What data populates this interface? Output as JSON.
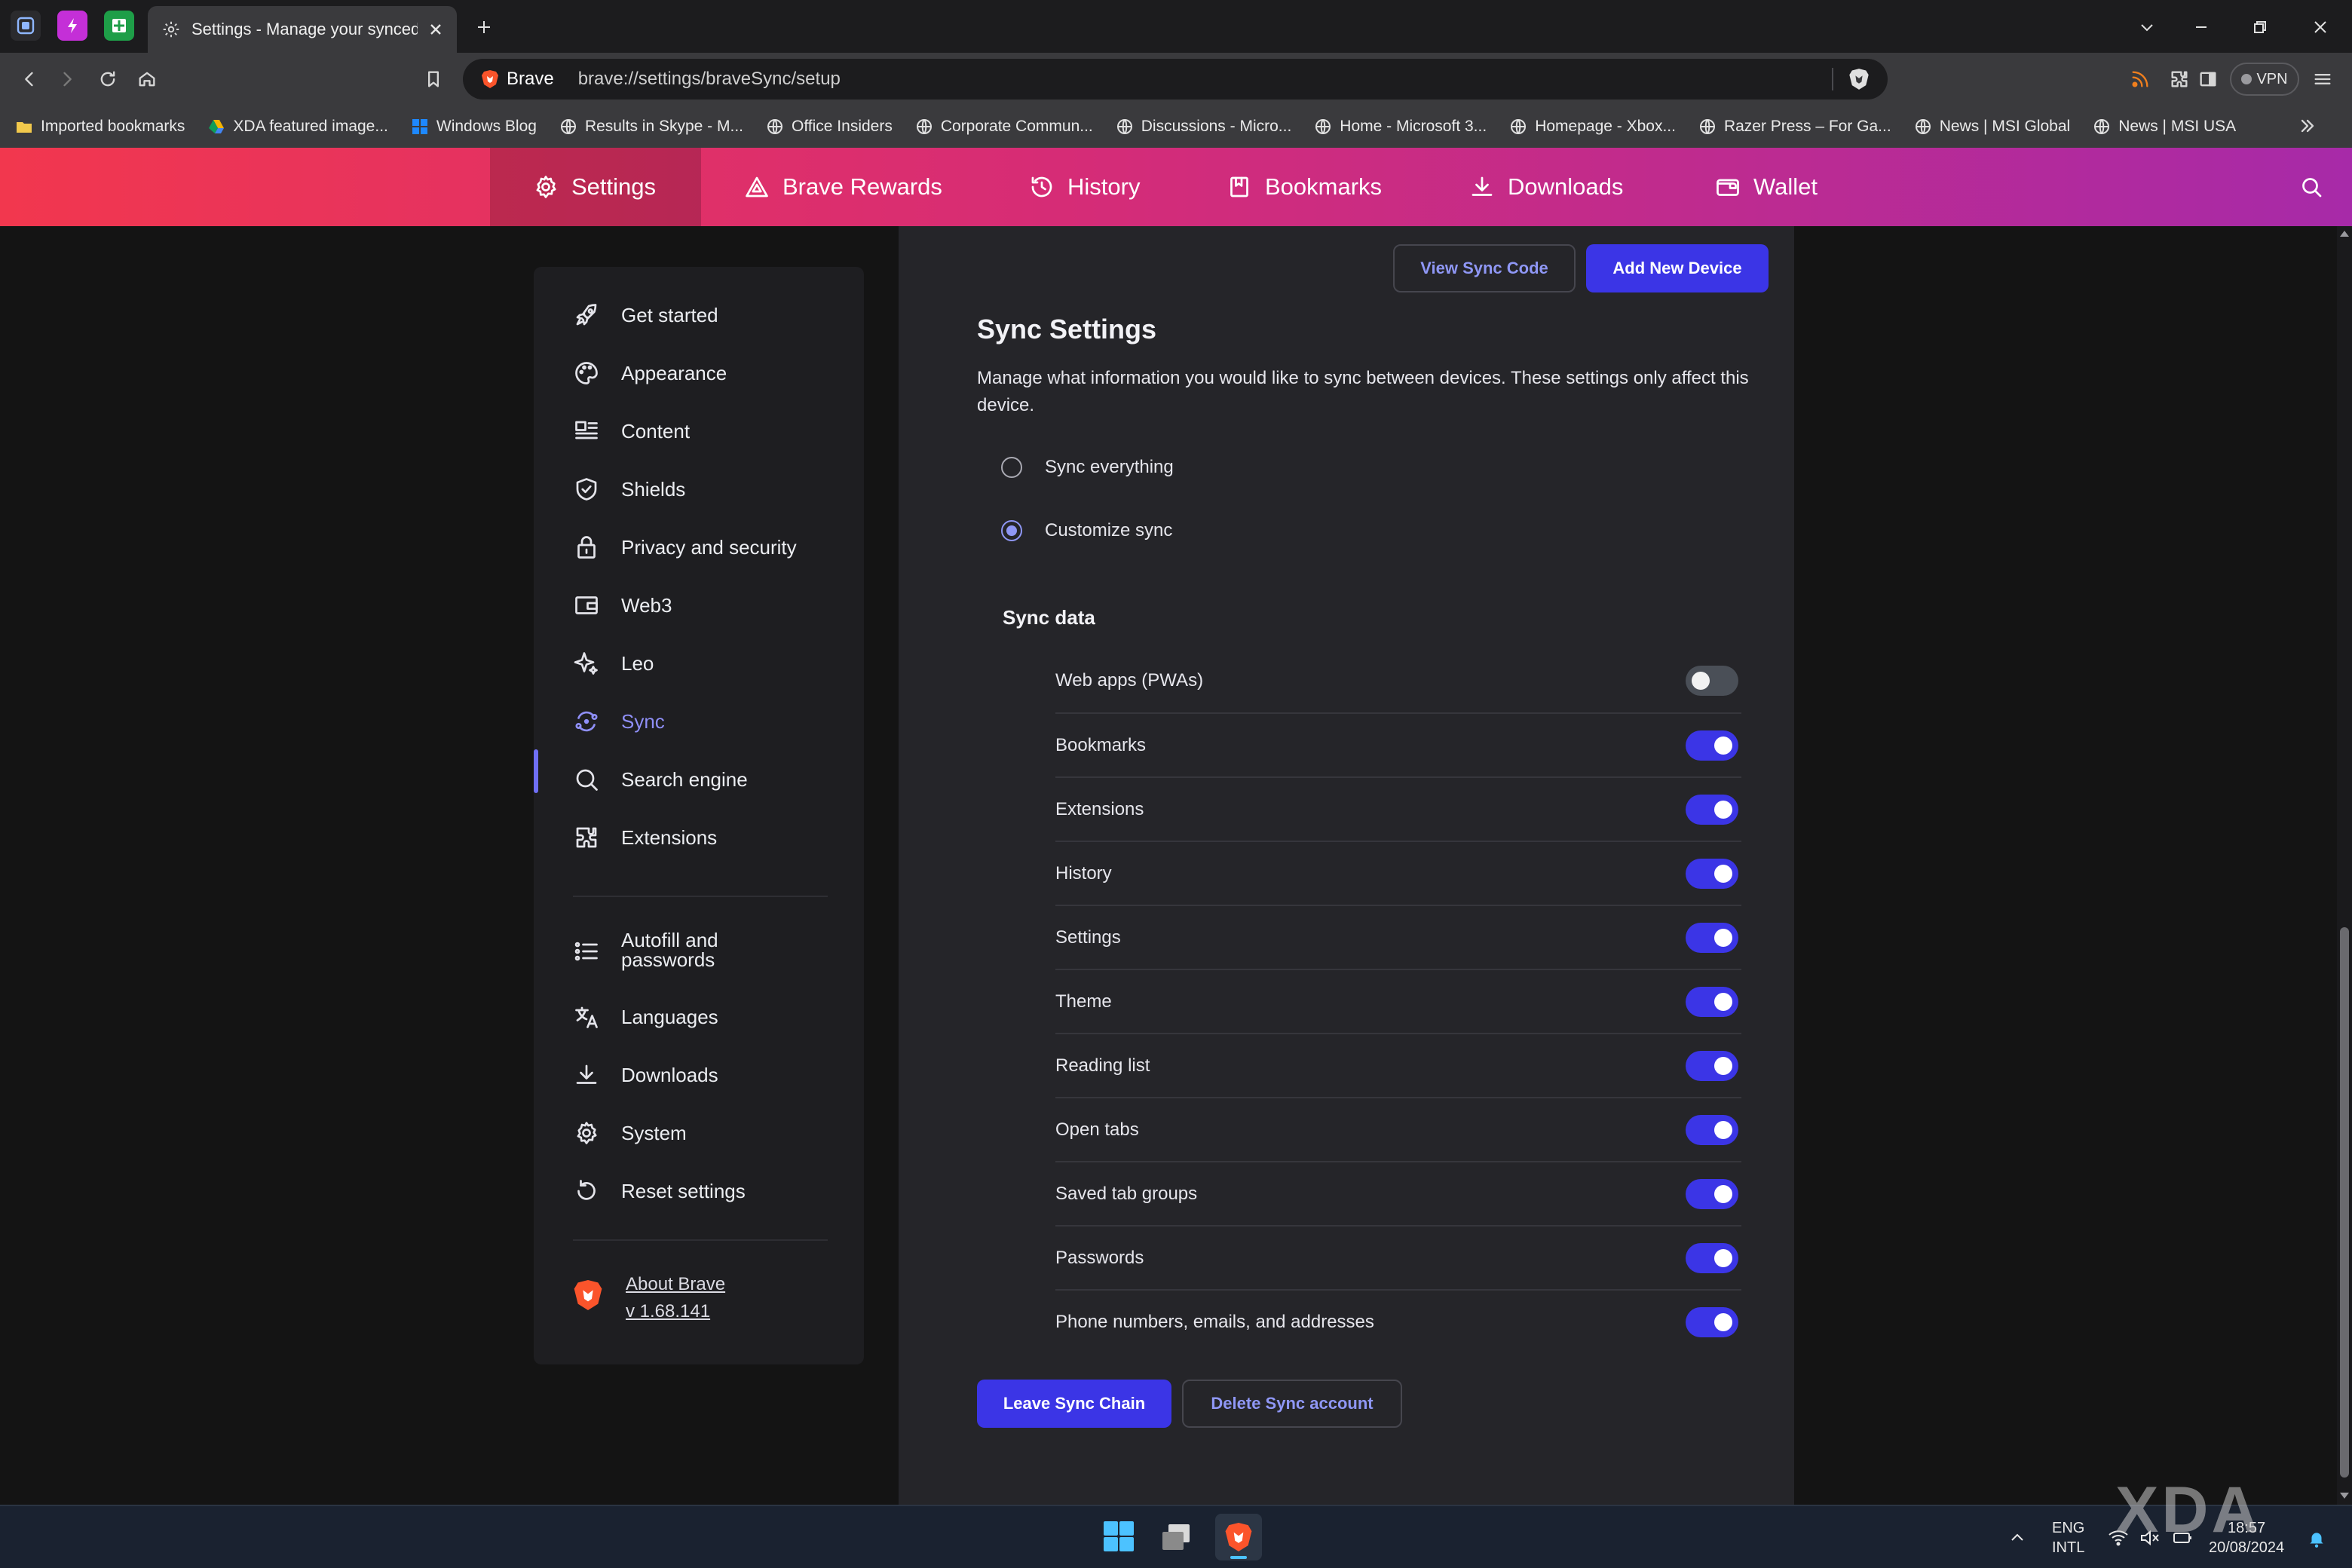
{
  "browser": {
    "tab_title": "Settings - Manage your synced",
    "brand": "Brave",
    "url": "brave://settings/braveSync/setup",
    "vpn_label": "VPN"
  },
  "bookmarks": [
    {
      "label": "Imported bookmarks",
      "icon": "folder-icon"
    },
    {
      "label": "XDA featured image...",
      "icon": "drive-icon"
    },
    {
      "label": "Windows Blog",
      "icon": "windows-icon"
    },
    {
      "label": "Results in Skype - M...",
      "icon": "globe-icon"
    },
    {
      "label": "Office Insiders",
      "icon": "globe-icon"
    },
    {
      "label": "Corporate Commun...",
      "icon": "globe-icon"
    },
    {
      "label": "Discussions - Micro...",
      "icon": "globe-icon"
    },
    {
      "label": "Home - Microsoft 3...",
      "icon": "globe-icon"
    },
    {
      "label": "Homepage - Xbox...",
      "icon": "globe-icon"
    },
    {
      "label": "Razer Press – For Ga...",
      "icon": "globe-icon"
    },
    {
      "label": "News | MSI Global",
      "icon": "globe-icon"
    },
    {
      "label": "News | MSI USA",
      "icon": "globe-icon"
    }
  ],
  "nav": {
    "settings": "Settings",
    "rewards": "Brave Rewards",
    "history": "History",
    "bookmarks": "Bookmarks",
    "downloads": "Downloads",
    "wallet": "Wallet"
  },
  "sidebar": {
    "items": [
      {
        "label": "Get started",
        "icon": "rocket-icon"
      },
      {
        "label": "Appearance",
        "icon": "palette-icon"
      },
      {
        "label": "Content",
        "icon": "content-icon"
      },
      {
        "label": "Shields",
        "icon": "shield-icon"
      },
      {
        "label": "Privacy and security",
        "icon": "lock-icon"
      },
      {
        "label": "Web3",
        "icon": "wallet-icon"
      },
      {
        "label": "Leo",
        "icon": "sparkle-icon"
      },
      {
        "label": "Sync",
        "icon": "sync-icon",
        "active": true
      },
      {
        "label": "Search engine",
        "icon": "search-icon"
      },
      {
        "label": "Extensions",
        "icon": "puzzle-icon"
      },
      {
        "label": "Autofill and passwords",
        "icon": "list-icon"
      },
      {
        "label": "Languages",
        "icon": "translate-icon"
      },
      {
        "label": "Downloads",
        "icon": "download-icon"
      },
      {
        "label": "System",
        "icon": "gear-icon"
      },
      {
        "label": "Reset settings",
        "icon": "reset-icon"
      }
    ],
    "about_label": "About Brave",
    "version": "v 1.68.141"
  },
  "sync": {
    "view_code_label": "View Sync Code",
    "add_device_label": "Add New Device",
    "title": "Sync Settings",
    "description": "Manage what information you would like to sync between devices. These settings only affect this device.",
    "options": [
      {
        "label": "Sync everything",
        "selected": false
      },
      {
        "label": "Customize sync",
        "selected": true
      }
    ],
    "data_label": "Sync data",
    "items": [
      {
        "label": "Web apps (PWAs)",
        "enabled": false
      },
      {
        "label": "Bookmarks",
        "enabled": true
      },
      {
        "label": "Extensions",
        "enabled": true
      },
      {
        "label": "History",
        "enabled": true
      },
      {
        "label": "Settings",
        "enabled": true
      },
      {
        "label": "Theme",
        "enabled": true
      },
      {
        "label": "Reading list",
        "enabled": true
      },
      {
        "label": "Open tabs",
        "enabled": true
      },
      {
        "label": "Saved tab groups",
        "enabled": true
      },
      {
        "label": "Passwords",
        "enabled": true
      },
      {
        "label": "Phone numbers, emails, and addresses",
        "enabled": true
      }
    ],
    "leave_label": "Leave Sync Chain",
    "delete_label": "Delete Sync account"
  },
  "taskbar": {
    "lang_top": "ENG",
    "lang_bottom": "INTL",
    "time": "18:57",
    "date": "20/08/2024"
  },
  "watermark": "XDA",
  "colors": {
    "accent": "#3b35e6",
    "accent_text": "#8f97f5",
    "nav_gradient_start": "#f2374e",
    "nav_gradient_end": "#a72aa8"
  }
}
